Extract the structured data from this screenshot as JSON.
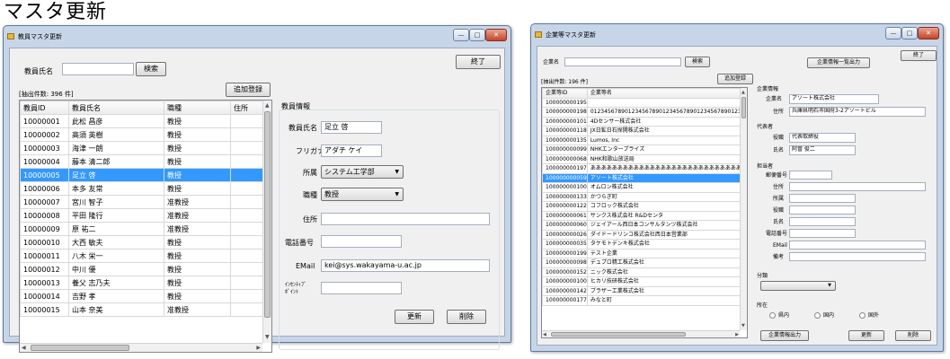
{
  "page_title": "マスタ更新",
  "left": {
    "title": "教員マスタ更新",
    "search_label": "教員氏名",
    "search_value": "",
    "search_button": "検索",
    "close_button": "終了",
    "count_text": "[抽出件数: 396 件]",
    "add_button": "追加登録",
    "columns": [
      "教員ID",
      "教員氏名",
      "職種",
      "住所"
    ],
    "rows": [
      [
        "10000001",
        "此松 昌彦",
        "教授"
      ],
      [
        "10000002",
        "高須 英樹",
        "教授"
      ],
      [
        "10000003",
        "海津 一朗",
        "教授"
      ],
      [
        "10000004",
        "藤本 清二郎",
        "教授"
      ],
      [
        "10000005",
        "足立 啓",
        "教授"
      ],
      [
        "10000006",
        "本多 友常",
        "教授"
      ],
      [
        "10000007",
        "宮川 智子",
        "准教授"
      ],
      [
        "10000008",
        "平田 隆行",
        "准教授"
      ],
      [
        "10000009",
        "原 祐二",
        "准教授"
      ],
      [
        "10000010",
        "大西 敏夫",
        "教授"
      ],
      [
        "10000011",
        "八木 栄一",
        "教授"
      ],
      [
        "10000012",
        "中川 優",
        "教授"
      ],
      [
        "10000013",
        "養父 志乃夫",
        "教授"
      ],
      [
        "10000014",
        "吉野 孝",
        "教授"
      ],
      [
        "10000015",
        "山本 奈美",
        "准教授"
      ]
    ],
    "selected_row": 4,
    "group_title": "教員情報",
    "f_name_label": "教員氏名",
    "f_name_value": "足立 啓",
    "f_kana_label": "フリガナ",
    "f_kana_value": "アダチ ケイ",
    "f_dept_label": "所属",
    "f_dept_value": "システム工学部",
    "f_rank_label": "職種",
    "f_rank_value": "教授",
    "f_addr_label": "住所",
    "f_addr_value": "",
    "f_tel_label": "電話番号",
    "f_tel_value": "",
    "f_email_label": "EMail",
    "f_email_value": "kei@sys.wakayama-u.ac.jp",
    "f_inc_label_1": "ｲﾝｾﾝﾃｨﾌﾞ",
    "f_inc_label_2": "ﾎﾟｲﾝﾄ",
    "f_inc_value": "",
    "update_button": "更新",
    "delete_button": "削除"
  },
  "right": {
    "title": "企業等マスタ更新",
    "search_label": "企業名",
    "search_value": "",
    "search_button": "検索",
    "list_button": "企業情報一覧出力",
    "close_button": "終了",
    "add_button": "追加登録",
    "count_text": "[抽出件数: 196 件]",
    "columns": [
      "企業等ID",
      "企業等名"
    ],
    "rows": [
      [
        "100000000195",
        ""
      ],
      [
        "100000000198",
        "0123456789012345678901234567890123456789012345"
      ],
      [
        "100000000101",
        "4Dセンサー株式会社"
      ],
      [
        "100000000118",
        "JX日鉱日石探開株式会社"
      ],
      [
        "100000000135",
        "Lumos, Inc"
      ],
      [
        "100000000099",
        "NHKエンタープライズ"
      ],
      [
        "100000000068",
        "NHK和歌山放送局"
      ],
      [
        "100000000197",
        "あああああああああああああああああああああああああああああああ"
      ],
      [
        "100000000059",
        "アソート株式会社"
      ],
      [
        "100000000100",
        "オムロン株式会社"
      ],
      [
        "100000000133",
        "かつらぎ町"
      ],
      [
        "100000000122",
        "コフロック株式会社"
      ],
      [
        "100000000061",
        "サンクス株式会社 R&Dセンタ"
      ],
      [
        "100000000060",
        "ジェイアール西日本コンサルタンツ株式会社"
      ],
      [
        "100000000026",
        "ダイドードリンコ株式会社西日本営業部"
      ],
      [
        "100000000035",
        "タケモトデンキ株式会社"
      ],
      [
        "100000000199",
        "テスト企業"
      ],
      [
        "100000000098",
        "デュプロ精工株式会社"
      ],
      [
        "100000000152",
        "ニック株式会社"
      ],
      [
        "100000000100",
        "ヒカリ技研株式会社"
      ],
      [
        "100000000142",
        "ブラザー工業株式会社"
      ],
      [
        "100000000177",
        "みなと町"
      ]
    ],
    "selected_row": 8,
    "sec_company": "企業情報",
    "company_name_label": "企業名",
    "company_name_value": "アソート株式会社",
    "company_addr_label": "住所",
    "company_addr_value": "兵庫県明石市国府3-2アソートビル",
    "sec_rep": "代表者",
    "rep_pos_label": "役職",
    "rep_pos_value": "代表取締役",
    "rep_name_label": "氏名",
    "rep_name_value": "阿曽 俊二",
    "sec_contact": "担当者",
    "c_zip_label": "郵便番号",
    "c_addr_label": "住所",
    "c_dept_label": "所属",
    "c_pos_label": "役職",
    "c_name_label": "氏名",
    "c_tel_label": "電話番号",
    "c_email_label": "EMail",
    "c_note_label": "備考",
    "sec_category": "分類",
    "category_value": "",
    "sec_location": "所在",
    "loc_opt1": "県内",
    "loc_opt2": "国内",
    "loc_opt3": "国外",
    "export_button": "企業情報出力",
    "update_button": "更新",
    "delete_button": "削除"
  },
  "colors": {
    "selection": "#3399ff",
    "window_frame": "#c7d5e8",
    "close_button": "#c3452a"
  }
}
